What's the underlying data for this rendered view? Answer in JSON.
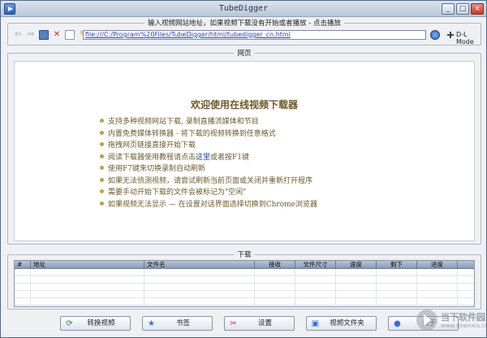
{
  "window": {
    "title": "TubeDigger",
    "controls": [
      "_",
      "□",
      "×"
    ]
  },
  "url_bar": {
    "legend": "输入视频网站地址，如果视频下载没有开始或者播放 - 点击播放",
    "value": "file:///C:/Program%20Files/TubeDigger/html/tubedigger_cn.html",
    "dl_mode_label": "D-L Mode",
    "toolbar_icons": [
      "back-arrow-icon",
      "forward-arrow-icon",
      "save-icon",
      "delete-icon",
      "document-icon",
      "pin-icon"
    ]
  },
  "web": {
    "legend": "网页",
    "welcome": "欢迎使用在线视频下载器",
    "features": [
      {
        "text": "支持多种视频网站下载, 录制直播流媒体和节目"
      },
      {
        "text": "内置免费媒体转换器 - 将下载的视频转换到任意格式"
      },
      {
        "text": "拖拽网页链接直接开始下载"
      },
      {
        "pre": "阅读下载器使用教程请点击",
        "link": "这里",
        "post": "或者按F1键"
      },
      {
        "text": "使用F7键来切换录制自动刷新"
      },
      {
        "text": "如果无法侦测视频，请尝试刷新当前页面或关闭并重新打开程序"
      },
      {
        "text": "需要手动开始下载的文件会被标记为\"空闲\""
      },
      {
        "text": "如果视频无法显示 — 在设置对话界面选择切换到Chrome浏览器"
      }
    ]
  },
  "downloads": {
    "legend": "下载",
    "columns": [
      "#",
      "地址",
      "文件名",
      "接收",
      "文件尺寸",
      "速度",
      "剩下",
      "进度",
      ""
    ]
  },
  "buttons": {
    "convert": "转换视频",
    "bookmarks": "书签",
    "settings": "设置",
    "video_folder": "视频文件夹",
    "about": "关于"
  },
  "watermark": {
    "text": "当下软件园",
    "url": "www.downxia.com"
  }
}
